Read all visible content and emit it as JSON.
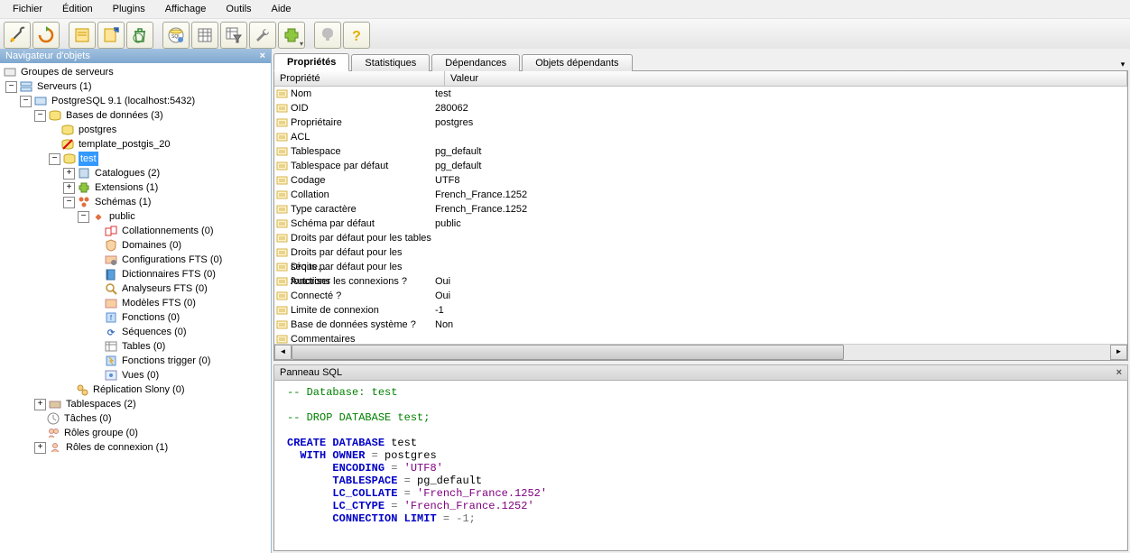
{
  "menu": [
    "Fichier",
    "Édition",
    "Plugins",
    "Affichage",
    "Outils",
    "Aide"
  ],
  "nav": {
    "title": "Navigateur d'objets",
    "tree": {
      "root": "Groupes de serveurs",
      "servers": "Serveurs (1)",
      "pg": "PostgreSQL 9.1 (localhost:5432)",
      "dbs": "Bases de données (3)",
      "db1": "postgres",
      "db2": "template_postgis_20",
      "db3": "test",
      "cat": "Catalogues (2)",
      "ext": "Extensions (1)",
      "sch": "Schémas (1)",
      "pub": "public",
      "coll": "Collationnements (0)",
      "dom": "Domaines (0)",
      "cfts": "Configurations FTS (0)",
      "dfts": "Dictionnaires FTS (0)",
      "afts": "Analyseurs FTS (0)",
      "mfts": "Modèles FTS (0)",
      "fn": "Fonctions (0)",
      "seq": "Séquences (0)",
      "tbl": "Tables (0)",
      "ftr": "Fonctions trigger (0)",
      "vue": "Vues (0)",
      "repl": "Réplication Slony (0)",
      "tsp": "Tablespaces (2)",
      "tch": "Tâches (0)",
      "rg": "Rôles groupe (0)",
      "rc": "Rôles de connexion (1)"
    }
  },
  "tabs": [
    "Propriétés",
    "Statistiques",
    "Dépendances",
    "Objets dépendants"
  ],
  "grid": {
    "hprop": "Propriété",
    "hval": "Valeur",
    "rows": [
      {
        "k": "Nom",
        "v": "test"
      },
      {
        "k": "OID",
        "v": "280062"
      },
      {
        "k": "Propriétaire",
        "v": "postgres"
      },
      {
        "k": "ACL",
        "v": ""
      },
      {
        "k": "Tablespace",
        "v": "pg_default"
      },
      {
        "k": "Tablespace par défaut",
        "v": "pg_default"
      },
      {
        "k": "Codage",
        "v": "UTF8"
      },
      {
        "k": "Collation",
        "v": "French_France.1252"
      },
      {
        "k": "Type caractère",
        "v": "French_France.1252"
      },
      {
        "k": "Schéma par défaut",
        "v": "public"
      },
      {
        "k": "Droits par défaut pour les tables",
        "v": ""
      },
      {
        "k": "Droits par défaut pour les séque...",
        "v": ""
      },
      {
        "k": "Droits par défaut pour les fonctions",
        "v": ""
      },
      {
        "k": "Autoriser les connexions ?",
        "v": "Oui"
      },
      {
        "k": "Connecté ?",
        "v": "Oui"
      },
      {
        "k": "Limite de connexion",
        "v": "-1"
      },
      {
        "k": "Base de données système ?",
        "v": "Non"
      },
      {
        "k": "Commentaires",
        "v": ""
      }
    ]
  },
  "sql": {
    "title": "Panneau SQL",
    "c1": "-- Database: test",
    "c2": "-- DROP DATABASE test;",
    "kw_create": "CREATE",
    "kw_database": "DATABASE",
    "id_test": "test",
    "kw_with": "WITH",
    "kw_owner": "OWNER",
    "op_eq": "=",
    "id_pg": "postgres",
    "kw_enc": "ENCODING",
    "s_utf8": "'UTF8'",
    "kw_tsp": "TABLESPACE",
    "id_tsp": "pg_default",
    "kw_lccol": "LC_COLLATE",
    "s_ff": "'French_France.1252'",
    "kw_lcctype": "LC_CTYPE",
    "kw_conn": "CONNECTION",
    "kw_limit": "LIMIT",
    "v_m1": "-1",
    "semi": ";"
  }
}
